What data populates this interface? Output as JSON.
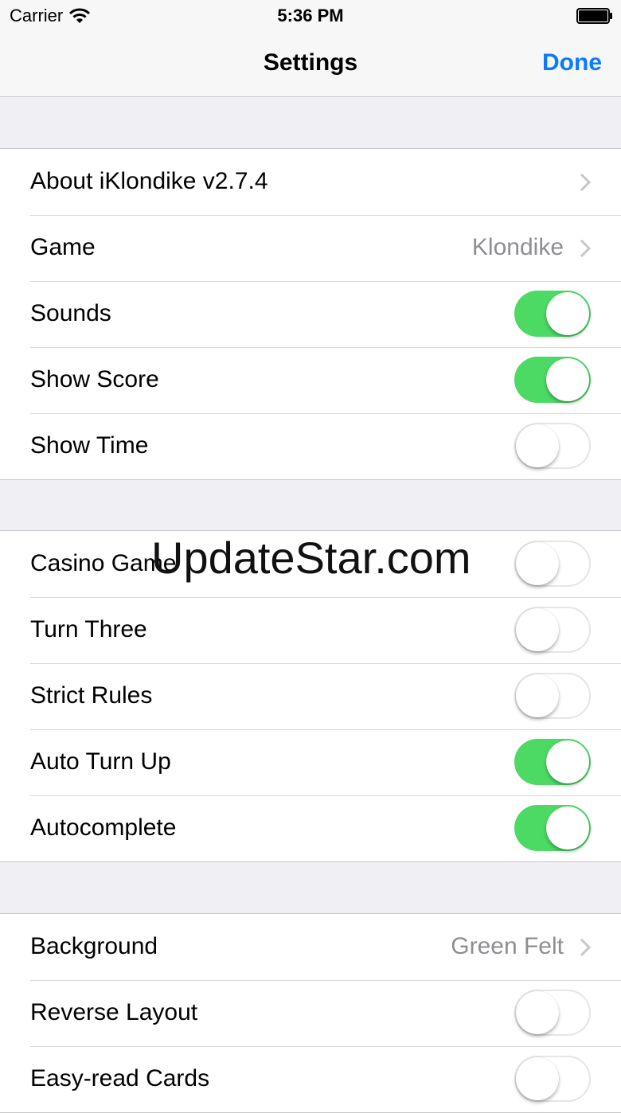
{
  "status_bar": {
    "carrier": "Carrier",
    "time": "5:36 PM"
  },
  "nav": {
    "title": "Settings",
    "done_label": "Done"
  },
  "colors": {
    "accent": "#0a7aff",
    "toggle_on": "#4cd964",
    "background": "#efeff4",
    "value_text": "#8e8e93"
  },
  "sections": [
    {
      "rows": [
        {
          "label": "About iKlondike v2.7.4",
          "type": "disclosure"
        },
        {
          "label": "Game",
          "type": "disclosure",
          "value": "Klondike"
        },
        {
          "label": "Sounds",
          "type": "toggle",
          "on": true
        },
        {
          "label": "Show Score",
          "type": "toggle",
          "on": true
        },
        {
          "label": "Show Time",
          "type": "toggle",
          "on": false
        }
      ]
    },
    {
      "rows": [
        {
          "label": "Casino Game",
          "type": "toggle",
          "on": false
        },
        {
          "label": "Turn Three",
          "type": "toggle",
          "on": false
        },
        {
          "label": "Strict Rules",
          "type": "toggle",
          "on": false
        },
        {
          "label": "Auto Turn Up",
          "type": "toggle",
          "on": true
        },
        {
          "label": "Autocomplete",
          "type": "toggle",
          "on": true
        }
      ]
    },
    {
      "rows": [
        {
          "label": "Background",
          "type": "disclosure",
          "value": "Green Felt"
        },
        {
          "label": "Reverse Layout",
          "type": "toggle",
          "on": false
        },
        {
          "label": "Easy-read Cards",
          "type": "toggle",
          "on": false
        }
      ]
    }
  ],
  "watermark": "UpdateStar.com"
}
